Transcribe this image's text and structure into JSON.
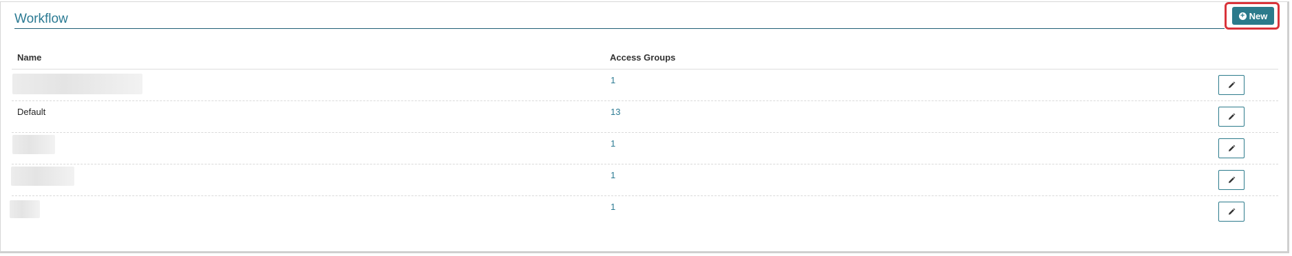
{
  "header": {
    "title": "Workflow",
    "new_button_label": "New",
    "new_button_icon": "plus-circle-icon"
  },
  "table": {
    "columns": [
      "Name",
      "Access Groups"
    ],
    "rows": [
      {
        "name": "",
        "name_redacted": true,
        "access_groups": "1",
        "edit_icon": "pencil-icon"
      },
      {
        "name": "Default",
        "name_redacted": false,
        "access_groups": "13",
        "edit_icon": "pencil-icon"
      },
      {
        "name": "",
        "name_redacted": true,
        "access_groups": "1",
        "edit_icon": "pencil-icon"
      },
      {
        "name": "",
        "name_redacted": true,
        "access_groups": "1",
        "edit_icon": "pencil-icon"
      },
      {
        "name": "",
        "name_redacted": true,
        "access_groups": "1",
        "edit_icon": "pencil-icon"
      }
    ]
  },
  "colors": {
    "accent": "#2b7a8b",
    "link": "#2b7a93",
    "highlight": "#d9333a"
  }
}
